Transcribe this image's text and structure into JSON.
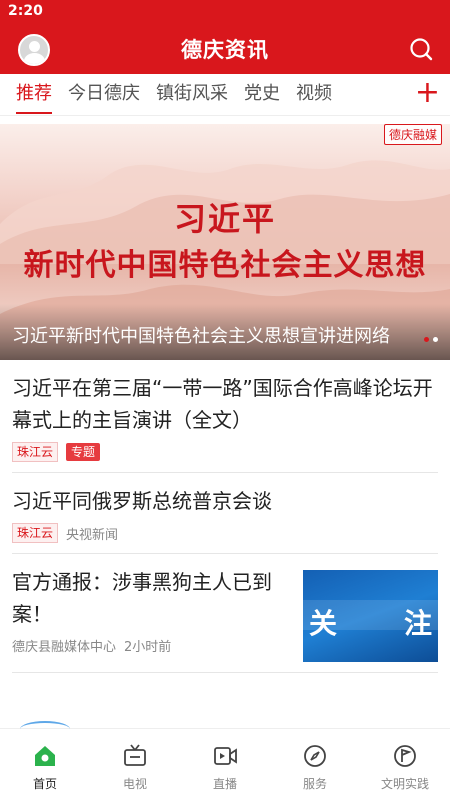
{
  "status_bar": {
    "time": "2:20"
  },
  "header": {
    "title": "德庆资讯"
  },
  "tabs": [
    {
      "label": "推荐",
      "active": true
    },
    {
      "label": "今日德庆"
    },
    {
      "label": "镇街风采"
    },
    {
      "label": "党史"
    },
    {
      "label": "视频"
    }
  ],
  "tab_add_label": "+",
  "banner": {
    "tag": "德庆融媒",
    "headline_line1": "习近平",
    "headline_line2": "新时代中国特色社会主义思想",
    "caption": "习近平新时代中国特色社会主义思想宣讲进网络",
    "slide_count": 2,
    "active_slide": 1
  },
  "news": [
    {
      "title": "习近平在第三届“一带一路”国际合作高峰论坛开幕式上的主旨演讲（全文）",
      "source_tag": "珠江云",
      "extra_tag": "专题"
    },
    {
      "title": "习近平同俄罗斯总统普京会谈",
      "source_tag": "珠江云",
      "source": "央视新闻"
    },
    {
      "title": "官方通报：涉事黑狗主人已到案！",
      "source": "德庆县融媒体中心",
      "time": "2小时前",
      "thumb_text_left": "关",
      "thumb_text_right": "注"
    }
  ],
  "bottom_nav": [
    {
      "label": "首页",
      "icon": "home-icon",
      "active": true
    },
    {
      "label": "电视",
      "icon": "tv-icon"
    },
    {
      "label": "直播",
      "icon": "live-icon"
    },
    {
      "label": "服务",
      "icon": "compass-icon"
    },
    {
      "label": "文明实践",
      "icon": "flag-icon"
    }
  ],
  "colors": {
    "brand_red": "#d9171c",
    "nav_active_green": "#2bb24c"
  }
}
